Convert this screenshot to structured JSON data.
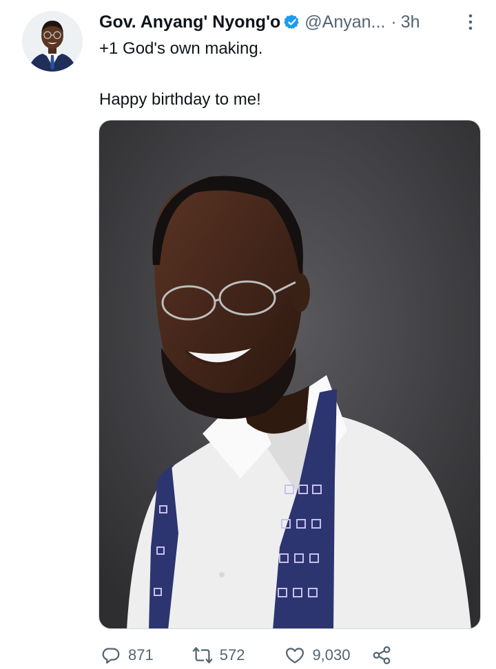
{
  "tweet": {
    "author_name": "Gov. Anyang' Nyong'o",
    "author_handle": "@Anyan...",
    "separator": "·",
    "time": "3h",
    "line1": "+1 God's own making.",
    "line2": "Happy birthday to me!",
    "verified": true
  },
  "metrics": {
    "replies": "871",
    "retweets": "572",
    "likes": "9,030"
  },
  "icons": [
    "avatar",
    "verified-badge-icon",
    "more-options-icon",
    "reply-icon",
    "retweet-icon",
    "like-icon",
    "share-icon"
  ],
  "colors": {
    "text": "#0f1419",
    "secondary": "#536471",
    "verified_blue": "#1d9bf0",
    "photo_background": "#3a3a3d",
    "shirt": "#f4f4f4",
    "suspenders": "#2c3570"
  }
}
